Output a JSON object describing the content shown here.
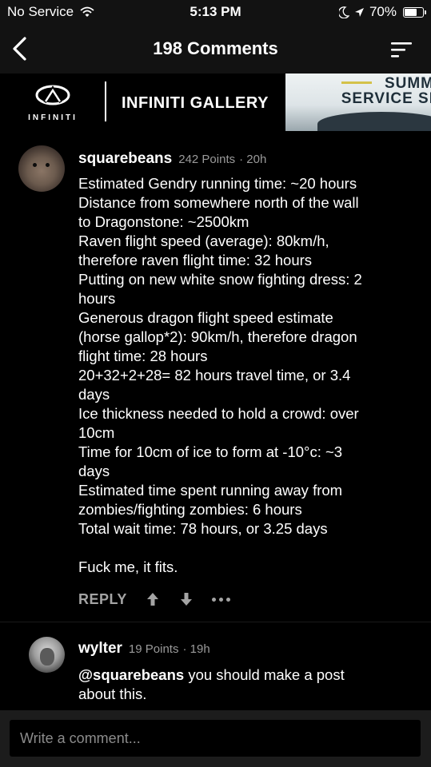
{
  "status_bar": {
    "carrier": "No Service",
    "time": "5:13 PM",
    "battery": "70%",
    "battery_level": 0.7
  },
  "nav": {
    "title": "198 Comments"
  },
  "ad": {
    "brand_word": "INFINITI",
    "gallery_label": "INFINITI GALLERY",
    "image_text_1": "SUMM",
    "image_text_2": "SERVICE SI"
  },
  "comments": [
    {
      "username": "squarebeans",
      "points": "242 Points",
      "age": "· 20h",
      "lines": [
        "Estimated Gendry running time: ~20 hours",
        "Distance from somewhere north of the wall",
        "to Dragonstone: ~2500km",
        "Raven flight speed (average): 80km/h,",
        "therefore raven flight time: 32 hours",
        "Putting on new white snow fighting dress: 2",
        "hours",
        "Generous dragon flight speed estimate",
        "(horse gallop*2): 90km/h, therefore dragon",
        "flight time: 28 hours",
        "20+32+2+28= 82 hours travel time, or 3.4",
        "days",
        "Ice thickness needed to hold a crowd: over",
        "10cm",
        "Time for 10cm of ice to form at -10°c: ~3",
        "days",
        "Estimated time spent running away from",
        "zombies/fighting zombies: 6 hours",
        "Total wait time: 78 hours, or 3.25 days",
        "",
        "Fuck me, it fits."
      ],
      "reply_label": "REPLY"
    },
    {
      "username": "wylter",
      "points": "19 Points",
      "age": "· 19h",
      "mention": "@squarebeans",
      "text_after_mention": " you should make a post",
      "line_2": "about this."
    }
  ],
  "input": {
    "placeholder": "Write a comment..."
  },
  "colors": {
    "background": "#000000",
    "bar": "#121212",
    "meta_text": "#9a9a9a",
    "action_grey": "#a4a4a4"
  }
}
